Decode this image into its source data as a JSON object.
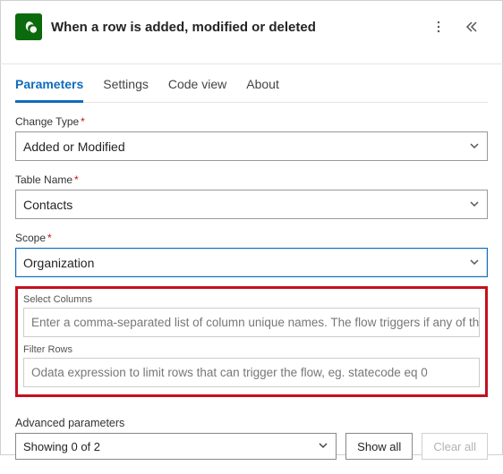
{
  "header": {
    "title": "When a row is added, modified or deleted"
  },
  "tabs": {
    "parameters": "Parameters",
    "settings": "Settings",
    "codeview": "Code view",
    "about": "About"
  },
  "fields": {
    "changeType": {
      "label": "Change Type",
      "value": "Added or Modified"
    },
    "tableName": {
      "label": "Table Name",
      "value": "Contacts"
    },
    "scope": {
      "label": "Scope",
      "value": "Organization"
    },
    "selectColumns": {
      "label": "Select Columns",
      "placeholder": "Enter a comma-separated list of column unique names. The flow triggers if any of th..."
    },
    "filterRows": {
      "label": "Filter Rows",
      "placeholder": "Odata expression to limit rows that can trigger the flow, eg. statecode eq 0"
    }
  },
  "advanced": {
    "label": "Advanced parameters",
    "value": "Showing 0 of 2",
    "showAll": "Show all",
    "clearAll": "Clear all"
  },
  "requiredMark": "*"
}
